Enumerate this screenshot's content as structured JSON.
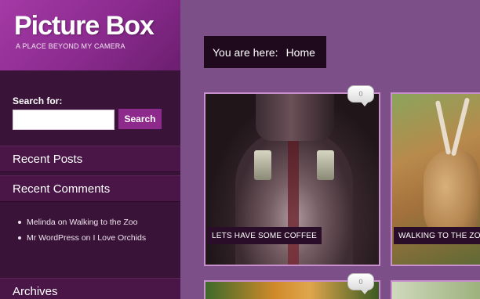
{
  "header": {
    "site_title": "Picture Box",
    "tagline": "A PLACE BEYOND MY CAMERA"
  },
  "sidebar": {
    "search_label": "Search for:",
    "search_value": "",
    "search_button": "Search",
    "widgets": {
      "recent_posts": "Recent Posts",
      "recent_comments": "Recent Comments",
      "archives": "Archives"
    },
    "comments": [
      {
        "author": "Melinda",
        "on": "on",
        "post": "Walking to the Zoo"
      },
      {
        "author": "Mr WordPress",
        "on": "on",
        "post": "I Love Orchids"
      }
    ]
  },
  "main": {
    "breadcrumb_prefix": "You are here:",
    "breadcrumb_current": "Home",
    "posts": [
      {
        "caption": "LETS HAVE SOME COFFEE",
        "comments": "0"
      },
      {
        "caption": "WALKING TO THE ZOO",
        "comments": ""
      },
      {
        "caption": "",
        "comments": "0"
      }
    ]
  },
  "colors": {
    "page_bg": "#7d4f89",
    "sidebar_bg": "#3a1438",
    "header_accent": "#9a33a0",
    "search_button": "#8e2a8c"
  }
}
